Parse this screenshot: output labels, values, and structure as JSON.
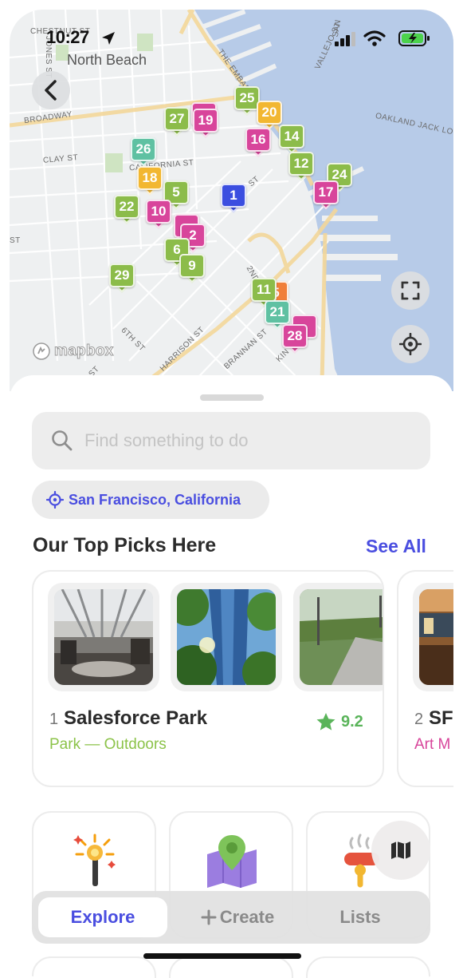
{
  "status_bar": {
    "time": "10:27"
  },
  "map": {
    "neighborhood": "North Beach",
    "streets": [
      "CHESTNUT ST",
      "JONES ST",
      "BROADWAY",
      "CLAY ST",
      "CALIFORNIA ST",
      "ST",
      "THE EMBARCADERO",
      "VALLEJO ST",
      "SAN",
      "OAKLAND JACK LO",
      "ST",
      "2ND",
      "6TH ST",
      "HARRISON ST",
      "BRANNAN ST",
      "KIN",
      "D ST"
    ],
    "attribution": "mapbox",
    "pins": [
      {
        "label": "25",
        "color": "#8cbc4a"
      },
      {
        "label": "20",
        "color": "#f2b731"
      },
      {
        "label": "27",
        "color": "#8cbc4a"
      },
      {
        "label": "19",
        "color": "#d8459b"
      },
      {
        "label": "16",
        "color": "#d8459b"
      },
      {
        "label": "14",
        "color": "#8cbc4a"
      },
      {
        "label": "26",
        "color": "#5fc1a2"
      },
      {
        "label": "12",
        "color": "#8cbc4a"
      },
      {
        "label": "24",
        "color": "#8cbc4a"
      },
      {
        "label": "18",
        "color": "#f2b731"
      },
      {
        "label": "5",
        "color": "#8cbc4a"
      },
      {
        "label": "1",
        "color": "#3b4ee0"
      },
      {
        "label": "17",
        "color": "#d8459b"
      },
      {
        "label": "22",
        "color": "#8cbc4a"
      },
      {
        "label": "10",
        "color": "#d8459b"
      },
      {
        "label": "2",
        "color": "#d8459b"
      },
      {
        "label": "6",
        "color": "#8cbc4a"
      },
      {
        "label": "9",
        "color": "#8cbc4a"
      },
      {
        "label": "29",
        "color": "#8cbc4a"
      },
      {
        "label": "11",
        "color": "#8cbc4a"
      },
      {
        "label": "5",
        "color": "#f07f3a"
      },
      {
        "label": "21",
        "color": "#5fc1a2"
      },
      {
        "label": "28",
        "color": "#d8459b"
      }
    ]
  },
  "search": {
    "placeholder": "Find something to do"
  },
  "location_chip": {
    "label": "San Francisco, California"
  },
  "top_picks": {
    "title": "Our Top Picks Here",
    "see_all": "See All",
    "cards": [
      {
        "rank": "1",
        "name": "Salesforce Park",
        "category": "Park — Outdoors",
        "rating": "9.2"
      },
      {
        "rank": "2",
        "name": "SF",
        "category": "Art M"
      }
    ]
  },
  "tab_bar": {
    "tabs": [
      {
        "label": "Explore",
        "active": true
      },
      {
        "label": "Create",
        "active": false
      },
      {
        "label": "Lists",
        "active": false
      }
    ]
  },
  "colors": {
    "accent": "#4a4ee0",
    "category_green": "#8cc34a",
    "category_pink": "#d8459b",
    "rating_green": "#5ab45a"
  }
}
